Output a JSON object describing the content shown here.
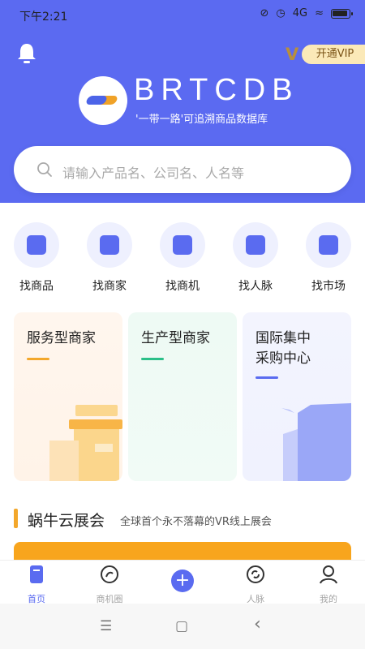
{
  "status": {
    "time": "下午2:21",
    "network": "4G"
  },
  "header": {
    "vip_label": "开通VIP",
    "brand": "BRTCDB",
    "slogan": "'一带一路'可追溯商品数据库",
    "colors": {
      "header_bg": "#5b6af1",
      "accent": "#f3a72b"
    }
  },
  "search": {
    "placeholder": "请输入产品名、公司名、人名等"
  },
  "quick_actions": [
    {
      "label": "找商品",
      "icon": "shopping-bag-icon"
    },
    {
      "label": "找商家",
      "icon": "storefront-icon"
    },
    {
      "label": "找商机",
      "icon": "opportunity-icon"
    },
    {
      "label": "找人脉",
      "icon": "contacts-icon"
    },
    {
      "label": "找市场",
      "icon": "market-bag-icon"
    }
  ],
  "categories": [
    {
      "title": "服务型商家",
      "line_color": "#f3a72b"
    },
    {
      "title": "生产型商家",
      "line_color": "#2bbf88"
    },
    {
      "title_line1": "国际集中",
      "title_line2": "采购中心",
      "line_color": "#5a6bf0"
    }
  ],
  "section": {
    "title": "蜗牛云展会",
    "subtitle": "全球首个永不落幕的VR线上展会"
  },
  "tabbar": {
    "items": [
      {
        "label": "首页",
        "icon": "home-icon",
        "active": true
      },
      {
        "label": "商机圈",
        "icon": "circle-icon",
        "active": false
      },
      {
        "label": "",
        "icon": "plus-icon",
        "active": false
      },
      {
        "label": "人脉",
        "icon": "network-icon",
        "active": false
      },
      {
        "label": "我的",
        "icon": "profile-icon",
        "active": false
      }
    ]
  },
  "system_nav": {
    "menu": "☰",
    "home": "▢",
    "back": "‹"
  }
}
